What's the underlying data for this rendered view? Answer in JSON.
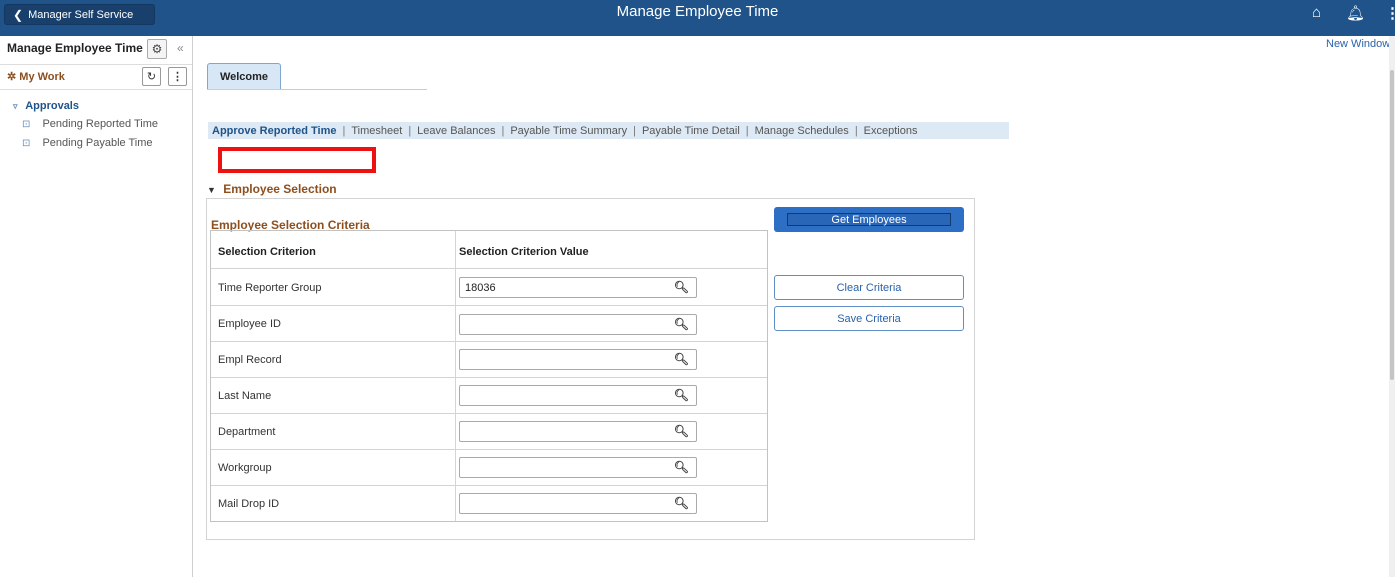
{
  "header": {
    "back_label": "Manager Self Service",
    "title": "Manage Employee Time",
    "home_icon": "home-icon",
    "bell_icon": "bell-icon",
    "more_icon": "more-vertical-icon"
  },
  "left_panel": {
    "title": "Manage Employee Time",
    "my_work_label": "My Work",
    "approvals_label": "Approvals",
    "nav_items": [
      {
        "label": "Pending Reported Time"
      },
      {
        "label": "Pending Payable Time"
      }
    ]
  },
  "main": {
    "new_window": "New Window",
    "tabs": [
      {
        "label": "Welcome"
      }
    ],
    "links": [
      {
        "label": "Approve Reported Time"
      },
      {
        "label": "Timesheet"
      },
      {
        "label": "Leave Balances"
      },
      {
        "label": "Payable Time Summary"
      },
      {
        "label": "Payable Time Detail"
      },
      {
        "label": "Manage Schedules"
      },
      {
        "label": "Exceptions"
      }
    ],
    "section_title": "Employee Selection",
    "criteria_title": "Employee Selection Criteria",
    "columns": [
      "Selection Criterion",
      "Selection Criterion Value"
    ],
    "rows": [
      {
        "label": "Time Reporter Group",
        "value": "18036"
      },
      {
        "label": "Employee ID",
        "value": ""
      },
      {
        "label": "Empl Record",
        "value": ""
      },
      {
        "label": "Last Name",
        "value": ""
      },
      {
        "label": "Department",
        "value": ""
      },
      {
        "label": "Workgroup",
        "value": ""
      },
      {
        "label": "Mail Drop ID",
        "value": ""
      }
    ],
    "buttons": {
      "get_employees": "Get Employees",
      "clear_criteria": "Clear Criteria",
      "save_criteria": "Save Criteria"
    }
  },
  "colors": {
    "header_bg": "#1f5389",
    "accent_brown": "#8d4f1e",
    "primary_button": "#2d6fc5",
    "highlight_red": "#ee1111"
  }
}
